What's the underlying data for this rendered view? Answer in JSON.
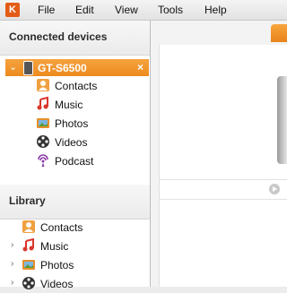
{
  "app": {
    "logo_text": "K"
  },
  "menu": {
    "file": "File",
    "edit": "Edit",
    "view": "View",
    "tools": "Tools",
    "help": "Help"
  },
  "sidebar": {
    "connected_header": "Connected devices",
    "device": {
      "name": "GT-S6500",
      "close": "×",
      "expand": "⌄"
    },
    "device_items": [
      {
        "label": "Contacts",
        "icon": "contacts-icon"
      },
      {
        "label": "Music",
        "icon": "music-note-icon"
      },
      {
        "label": "Photos",
        "icon": "photos-icon"
      },
      {
        "label": "Videos",
        "icon": "film-reel-icon"
      },
      {
        "label": "Podcast",
        "icon": "podcast-icon"
      }
    ],
    "library_header": "Library",
    "library_items": [
      {
        "label": "Contacts",
        "icon": "contacts-icon"
      },
      {
        "label": "Music",
        "icon": "music-note-icon",
        "expander": "›"
      },
      {
        "label": "Photos",
        "icon": "photos-icon",
        "expander": "›"
      },
      {
        "label": "Videos",
        "icon": "film-reel-icon",
        "expander": "›"
      }
    ]
  },
  "colors": {
    "accent": "#ec8b1d",
    "music": "#d9362b",
    "podcast": "#8a3aa6",
    "contacts": "#f0a040"
  }
}
